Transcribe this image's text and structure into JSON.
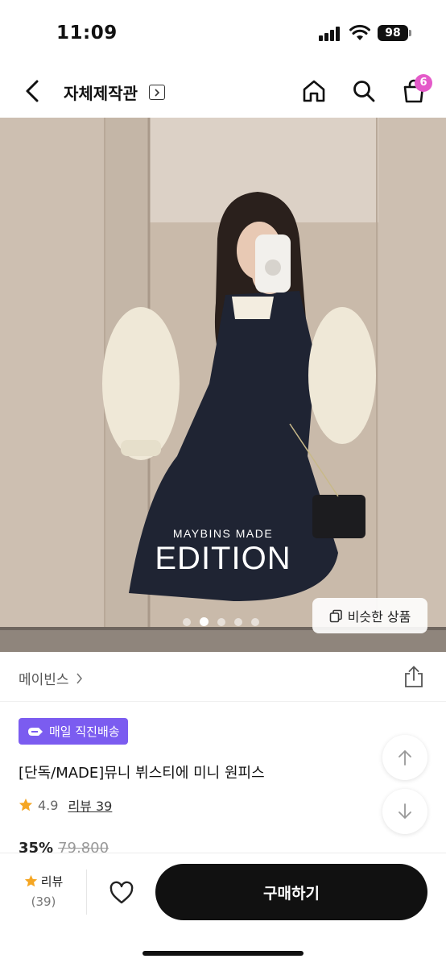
{
  "status": {
    "time": "11:09",
    "battery": "98"
  },
  "header": {
    "shop_title": "자체제작관",
    "icons": [
      "back-icon",
      "home-icon",
      "search-icon",
      "cart-icon"
    ],
    "cart_count": "6",
    "badge_color": "#e45ac9"
  },
  "hero": {
    "brand_small": "MAYBINS MADE",
    "brand_big": "EDITION",
    "slide_count": 5,
    "active_slide": 1,
    "similar_button": "비슷한 상품"
  },
  "brand": {
    "name": "메이빈스"
  },
  "product": {
    "delivery_badge": "매일 직진배송",
    "delivery_color": "#7b5cf0",
    "name": "[단독/MADE]뮤니 뷔스티에 미니 원피스",
    "rating": "4.9",
    "review_link": "리뷰 39",
    "discount": "35%",
    "original_price": "79,800"
  },
  "bottom_bar": {
    "review_label": "리뷰",
    "review_count": "(39)",
    "buy_label": "구매하기"
  }
}
